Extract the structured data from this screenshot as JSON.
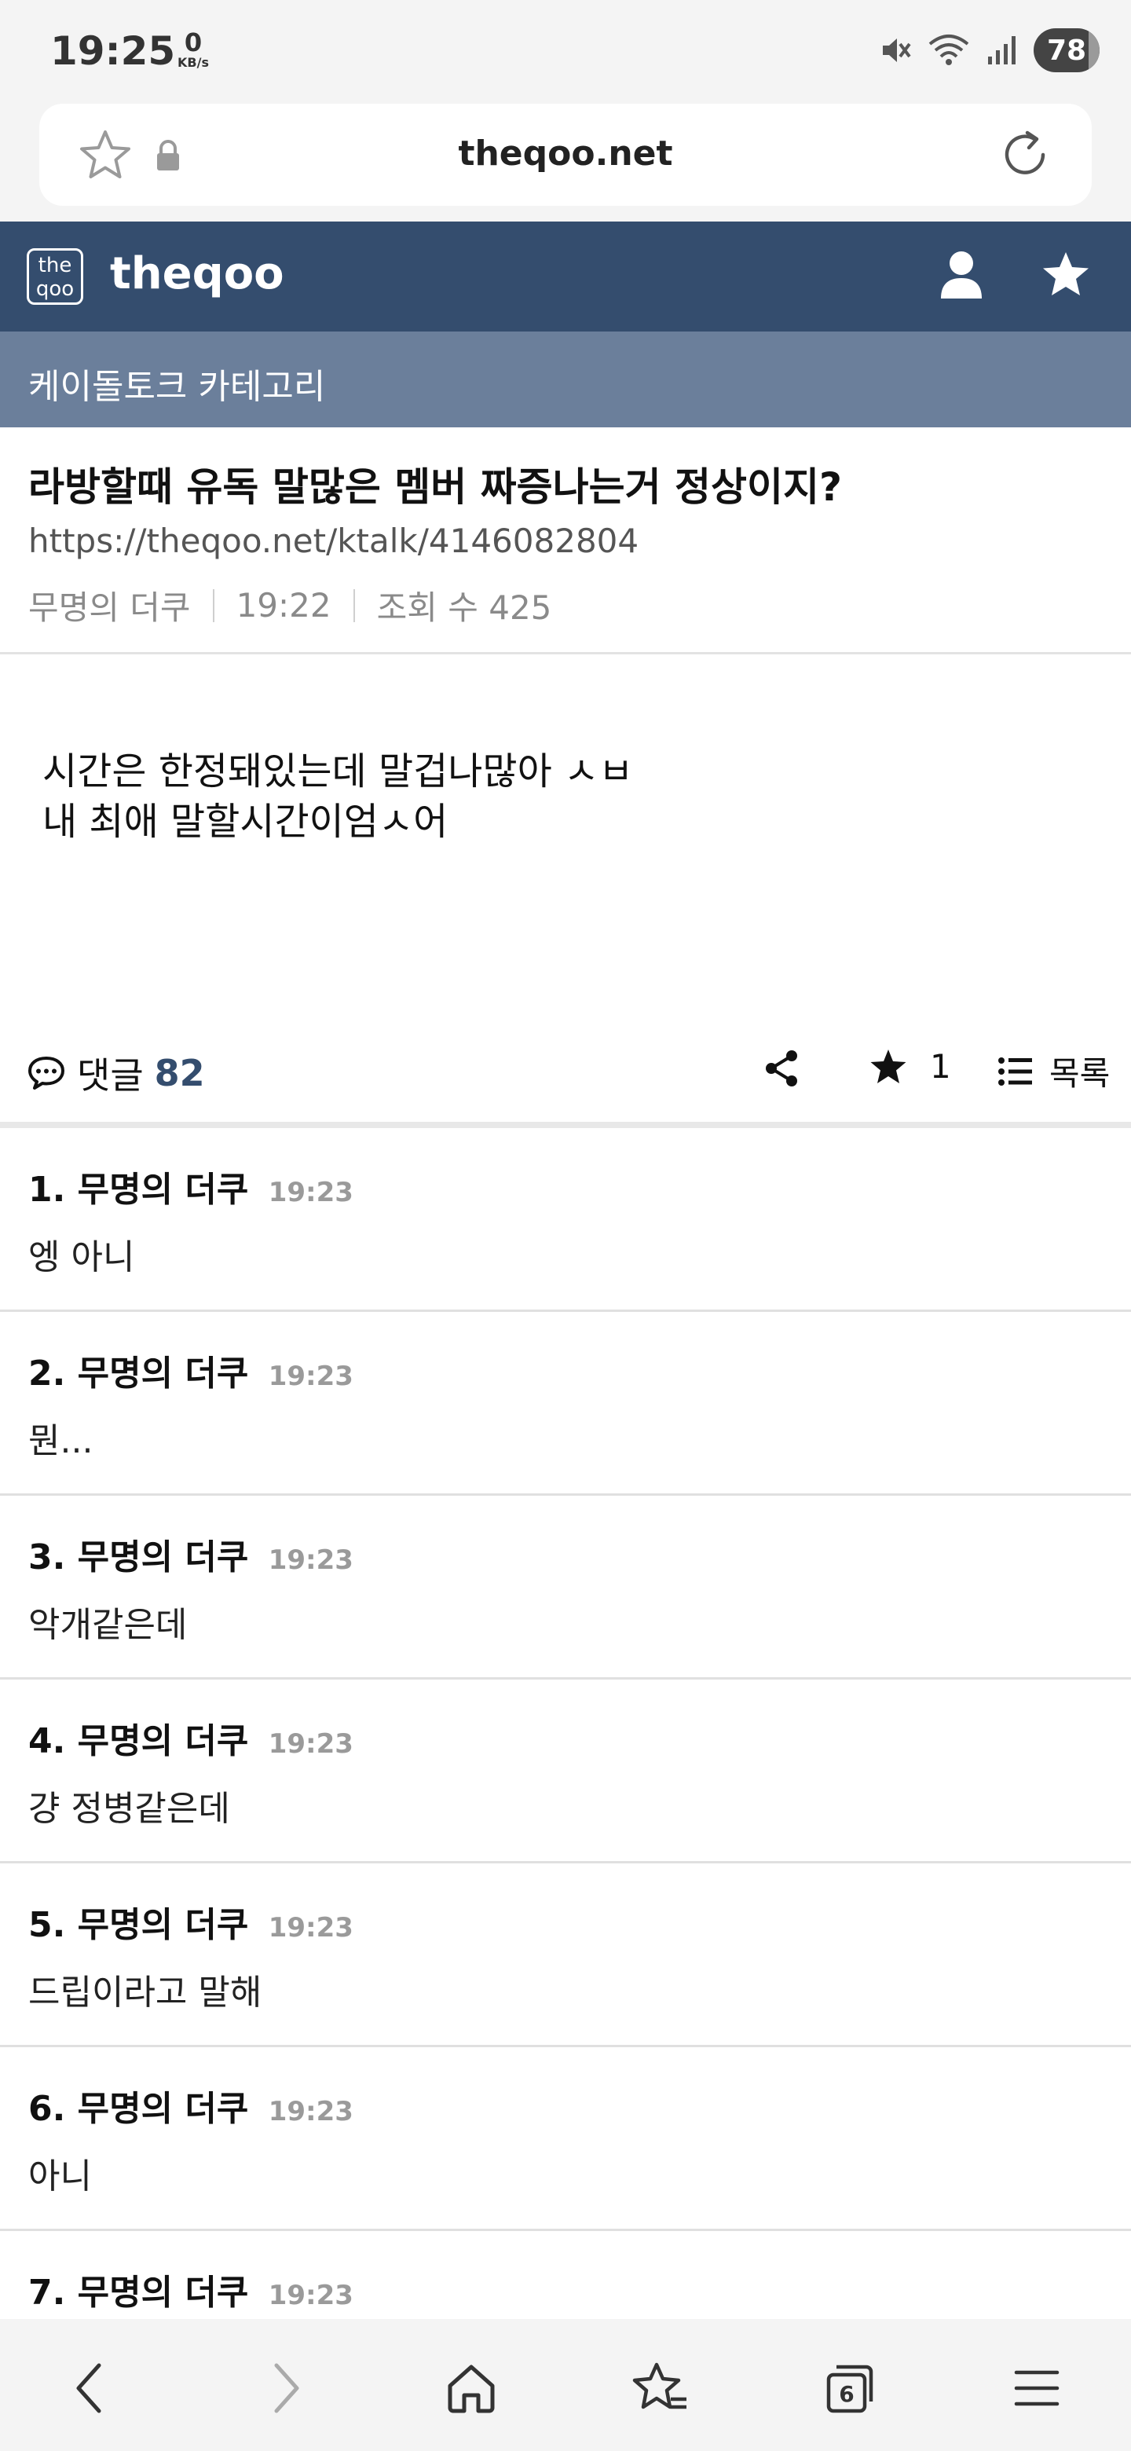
{
  "status_bar": {
    "time": "19:25",
    "net_speed": "0",
    "net_unit": "KB/s",
    "battery": "78",
    "icons": [
      "mute-icon",
      "wifi-icon",
      "signal-icon",
      "battery-icon"
    ]
  },
  "browser": {
    "url": "theqoo.net",
    "tab_count": "6"
  },
  "site": {
    "logo_text_top": "the",
    "logo_text_bottom": "qoo",
    "name": "theqoo",
    "category": "케이돌토크 카테고리",
    "header_color": "#344d6e"
  },
  "post": {
    "title": "라방할때 유독 말많은 멤버 짜증나는거 정상이지?",
    "url": "https://theqoo.net/ktalk/4146082804",
    "author": "무명의 더쿠",
    "time": "19:22",
    "views": "조회 수 425",
    "body_line1": "시간은 한정돼있는데 말겁나많아 ㅅㅂ",
    "body_line2": "내 최애 말할시간이엄ㅅ어"
  },
  "actions": {
    "comment_label": "댓글",
    "comment_count": "82",
    "favorite_count": "1",
    "list_label": "목록"
  },
  "comments": [
    {
      "num": "1.",
      "author": "무명의 더쿠",
      "time": "19:23",
      "text": "엥 아니"
    },
    {
      "num": "2.",
      "author": "무명의 더쿠",
      "time": "19:23",
      "text": "뭔..."
    },
    {
      "num": "3.",
      "author": "무명의 더쿠",
      "time": "19:23",
      "text": "악개같은데"
    },
    {
      "num": "4.",
      "author": "무명의 더쿠",
      "time": "19:23",
      "text": "걍 정병같은데"
    },
    {
      "num": "5.",
      "author": "무명의 더쿠",
      "time": "19:23",
      "text": "드립이라고 말해"
    },
    {
      "num": "6.",
      "author": "무명의 더쿠",
      "time": "19:23",
      "text": "아니"
    },
    {
      "num": "7.",
      "author": "무명의 더쿠",
      "time": "19:23",
      "text": ""
    }
  ]
}
